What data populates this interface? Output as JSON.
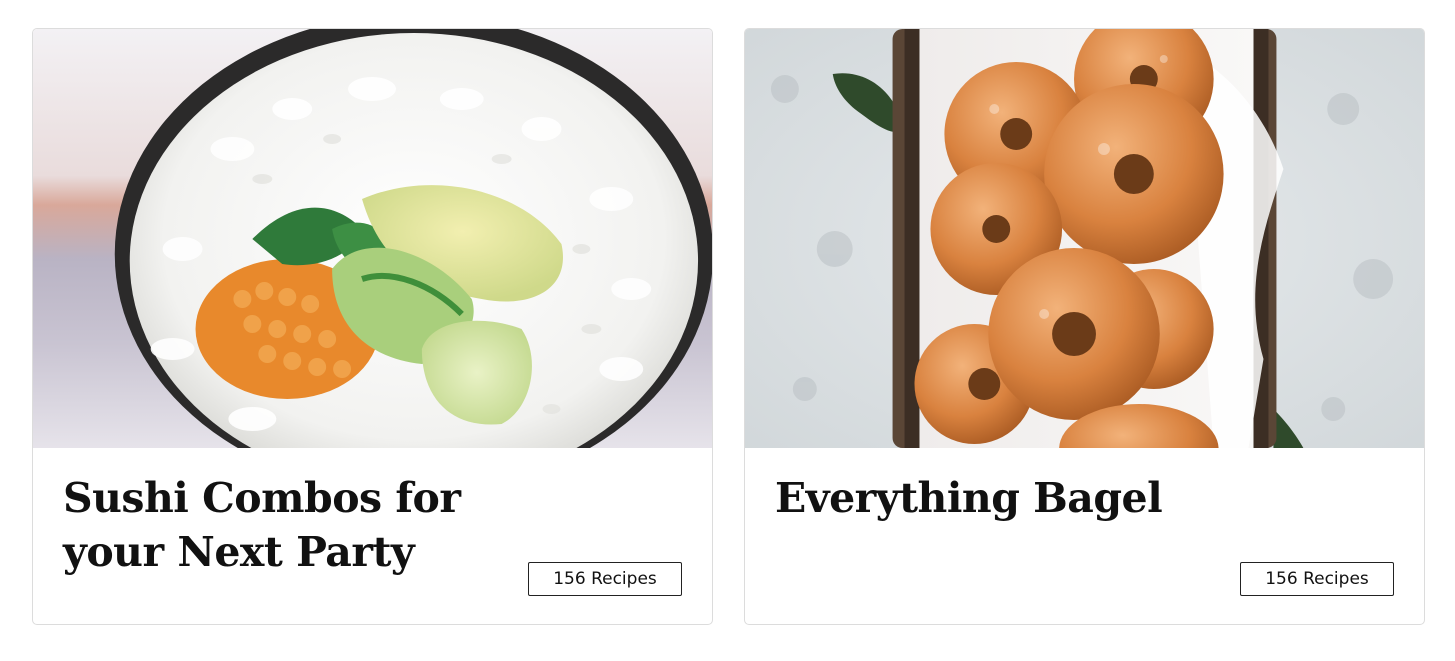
{
  "cards": [
    {
      "title": "Sushi Combos for your Next Party",
      "badge": "156 Recipes",
      "image_subject": "sushi-roll-photo"
    },
    {
      "title": "Everything Bagel",
      "badge": "156 Recipes",
      "image_subject": "bagels-in-basket-photo"
    }
  ],
  "colors": {
    "card_border": "#dcdcdc",
    "title_text": "#111111",
    "badge_border": "#222222"
  }
}
